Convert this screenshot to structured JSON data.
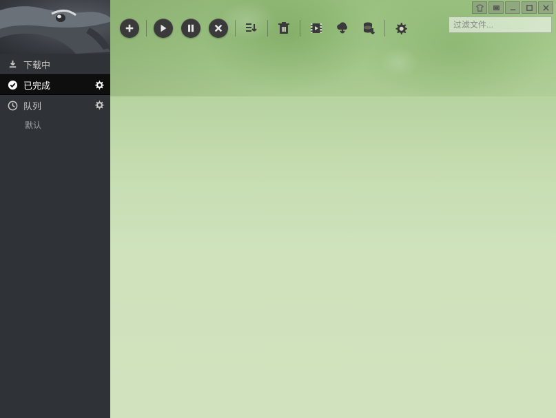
{
  "filter": {
    "placeholder": "过滤文件..."
  },
  "sidebar": {
    "downloading_label": "下载中",
    "completed_label": "已完成",
    "queue_label": "队列",
    "default_sub_label": "默认"
  },
  "toolbar": {
    "add": "add",
    "play": "play",
    "pause": "pause",
    "cancel": "cancel",
    "sort": "sort",
    "delete": "delete",
    "media": "media",
    "cloud_download": "cloud_download",
    "database": "database",
    "settings": "settings"
  },
  "titlebar": {
    "skin": "skin",
    "compact": "compact",
    "minimize": "minimize",
    "maximize": "maximize",
    "close": "close"
  }
}
